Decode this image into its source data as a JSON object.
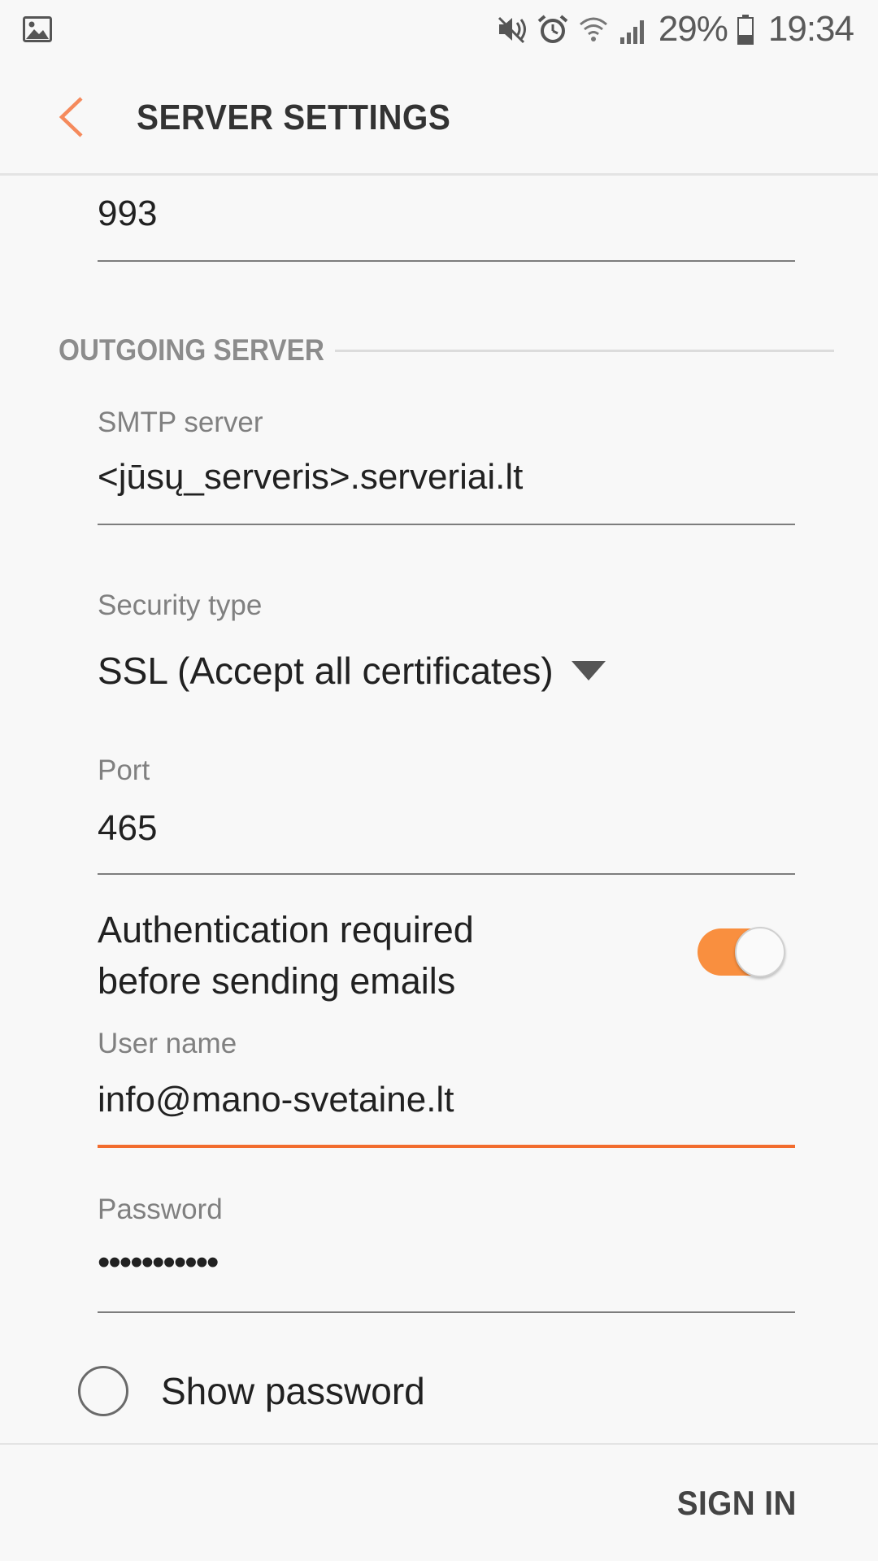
{
  "status_bar": {
    "battery": "29%",
    "time": "19:34",
    "icons": [
      "gallery-icon",
      "mute-icon",
      "alarm-icon",
      "wifi-icon",
      "signal-icon",
      "battery-icon"
    ]
  },
  "header": {
    "title": "SERVER SETTINGS",
    "back_icon": "chevron-left-icon"
  },
  "incoming": {
    "port_value": "993"
  },
  "outgoing": {
    "section_title": "OUTGOING SERVER",
    "smtp_label": "SMTP server",
    "smtp_value": "<jūsų_serveris>.serveriai.lt",
    "security_label": "Security type",
    "security_value": "SSL (Accept all certificates)",
    "port_label": "Port",
    "port_value": "465",
    "auth_line1": "Authentication required",
    "auth_line2": "before sending emails",
    "auth_enabled": true,
    "username_label": "User name",
    "username_value": "info@mano-svetaine.lt",
    "password_label": "Password",
    "password_value": "•••••••••••",
    "show_password_label": "Show password",
    "show_password_checked": false
  },
  "footer": {
    "sign_in_label": "SIGN IN"
  },
  "colors": {
    "accent": "#f26c2e",
    "toggle_track": "#f98f3f",
    "background": "#f8f8f8",
    "label_gray": "#808080"
  }
}
